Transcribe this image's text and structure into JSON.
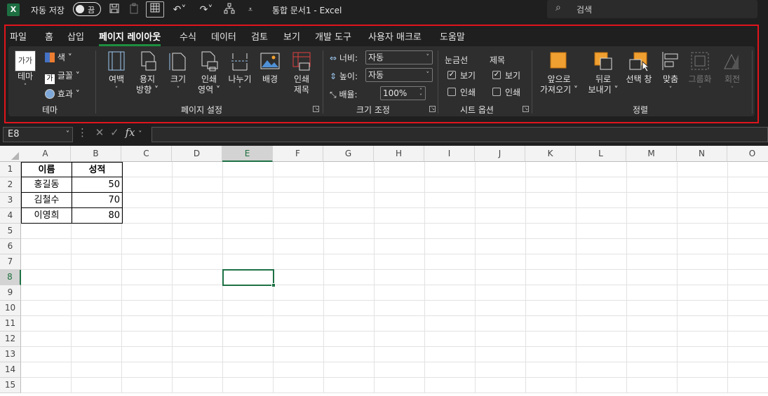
{
  "title_bar": {
    "app_badge": "X",
    "autosave_label": "자동 저장",
    "autosave_state": "끔",
    "doc_title": "통합 문서1 - Excel",
    "search_placeholder": "검색"
  },
  "tabs": [
    "파일",
    "홈",
    "삽입",
    "페이지 레이아웃",
    "수식",
    "데이터",
    "검토",
    "보기",
    "개발 도구",
    "사용자 매크로",
    "도움말"
  ],
  "active_tab": "페이지 레이아웃",
  "ribbon": {
    "theme": {
      "group": "테마",
      "theme_btn": "테마",
      "theme_icon_text": "가가",
      "color": "색",
      "font": "글꼴",
      "effect": "효과"
    },
    "page_setup": {
      "group": "페이지 설정",
      "margins": "여백",
      "orientation_1": "용지",
      "orientation_2": "방향",
      "size": "크기",
      "print_area_1": "인쇄",
      "print_area_2": "영역",
      "breaks": "나누기",
      "background": "배경",
      "print_titles_1": "인쇄",
      "print_titles_2": "제목"
    },
    "scale": {
      "group": "크기 조정",
      "width_label": "너비:",
      "width_value": "자동",
      "height_label": "높이:",
      "height_value": "자동",
      "scale_label": "배율:",
      "scale_value": "100%"
    },
    "sheet_options": {
      "group": "시트 옵션",
      "gridlines": "눈금선",
      "headings": "제목",
      "view": "보기",
      "print": "인쇄",
      "gridlines_view_checked": true,
      "headings_view_checked": true
    },
    "arrange": {
      "group": "정렬",
      "bring_forward_1": "앞으로",
      "bring_forward_2": "가져오기",
      "send_backward_1": "뒤로",
      "send_backward_2": "보내기",
      "selection_pane": "선택 창",
      "align": "맞춤",
      "group_btn": "그룹화",
      "rotate": "회전"
    }
  },
  "formula_bar": {
    "name_box": "E8",
    "fx": "fx",
    "formula": ""
  },
  "sheet": {
    "columns": [
      "A",
      "B",
      "C",
      "D",
      "E",
      "F",
      "G",
      "H",
      "I",
      "J",
      "K",
      "L",
      "M",
      "N",
      "O"
    ],
    "rows": [
      "1",
      "2",
      "3",
      "4",
      "5",
      "6",
      "7",
      "8",
      "9",
      "10",
      "11",
      "12",
      "13",
      "14",
      "15"
    ],
    "selected_cell": "E8",
    "table": {
      "headers": [
        "이름",
        "성적"
      ],
      "rows": [
        [
          "홍길동",
          "50"
        ],
        [
          "김철수",
          "70"
        ],
        [
          "이영희",
          "80"
        ]
      ]
    }
  },
  "colors": {
    "accent_green": "#1e7145",
    "highlight_red": "#e0141c",
    "arrange_orange": "#f0a030"
  }
}
